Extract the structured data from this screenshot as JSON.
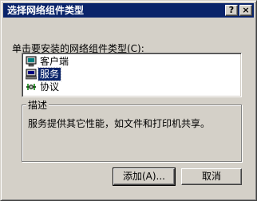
{
  "window": {
    "title": "选择网络组件类型",
    "help_glyph": "?",
    "close_glyph": "×"
  },
  "prompt": "单击要安装的网络组件类型(C):",
  "components": [
    {
      "label": "客户端",
      "icon": "monitor-icon",
      "selected": false
    },
    {
      "label": "服务",
      "icon": "service-icon",
      "selected": true
    },
    {
      "label": "协议",
      "icon": "protocol-icon",
      "selected": false
    }
  ],
  "description": {
    "legend": "描述",
    "text": "服务提供其它性能，如文件和打印机共享。"
  },
  "buttons": {
    "add": "添加(A)...",
    "cancel": "取消"
  },
  "colors": {
    "titlebar": "#0a246a",
    "face": "#d4d0c8",
    "selection": "#0a246a"
  }
}
